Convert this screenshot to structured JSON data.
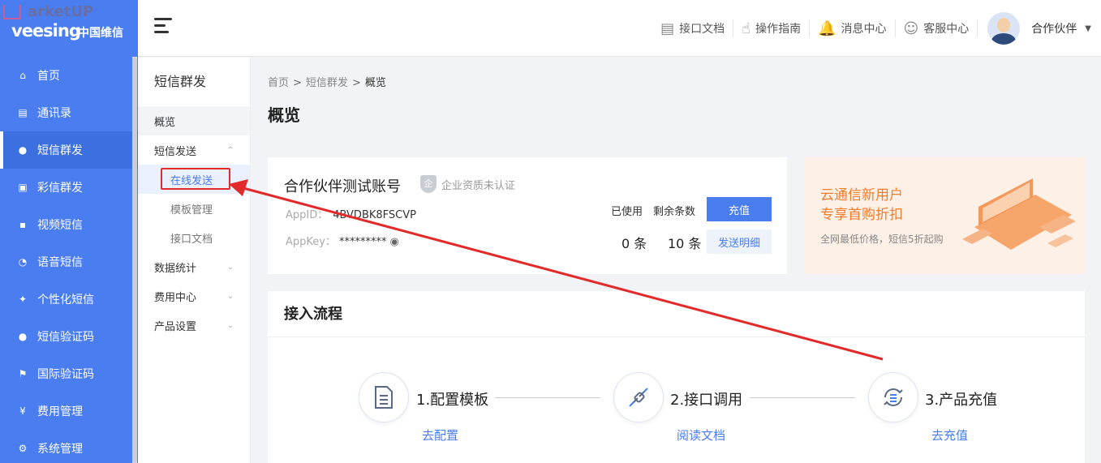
{
  "logo": {
    "watermark": "arketUP",
    "brand": "veesing",
    "brand_cn": "中国维信"
  },
  "sidebar": {
    "items": [
      {
        "label": "首页",
        "icon": "home-icon"
      },
      {
        "label": "通讯录",
        "icon": "contacts-icon"
      },
      {
        "label": "短信群发",
        "icon": "sms-icon"
      },
      {
        "label": "彩信群发",
        "icon": "mms-icon"
      },
      {
        "label": "视频短信",
        "icon": "video-sms-icon"
      },
      {
        "label": "语音短信",
        "icon": "voice-sms-icon"
      },
      {
        "label": "个性化短信",
        "icon": "personalized-sms-icon"
      },
      {
        "label": "短信验证码",
        "icon": "sms-code-icon"
      },
      {
        "label": "国际验证码",
        "icon": "intl-code-icon"
      },
      {
        "label": "费用管理",
        "icon": "yen-icon"
      },
      {
        "label": "系统管理",
        "icon": "gear-icon"
      }
    ],
    "active_index": 2
  },
  "header": {
    "links": [
      {
        "label": "接口文档",
        "icon": "api-doc-icon"
      },
      {
        "label": "操作指南",
        "icon": "hand-pointer-icon"
      },
      {
        "label": "消息中心",
        "icon": "bell-icon"
      },
      {
        "label": "客服中心",
        "icon": "support-icon"
      }
    ],
    "user": "合作伙伴"
  },
  "subnav": {
    "title": "短信群发",
    "overview": "概览",
    "send": "短信发送",
    "send_children": [
      "在线发送",
      "模板管理",
      "接口文档"
    ],
    "stats": "数据统计",
    "billing": "费用中心",
    "product": "产品设置"
  },
  "breadcrumb": {
    "home": "首页",
    "section": "短信群发",
    "current": "概览",
    "sep": ">"
  },
  "page_title": "概览",
  "account": {
    "name": "合作伙伴测试账号",
    "cert_badge": "企",
    "cert_text": "企业资质未认证",
    "appid_label": "AppID：",
    "appid_value": "4BVDBK8FSCVP",
    "appkey_label": "AppKey：",
    "appkey_value": "*********",
    "used_label": "已使用",
    "remain_label": "剩余条数",
    "used_value": "0 条",
    "remain_value": "10 条",
    "recharge_button": "充值",
    "detail_button": "发送明细"
  },
  "promo": {
    "line1": "云通信新用户",
    "line2": "专享首购折扣",
    "sub": "全网最低价格，短信5折起购"
  },
  "flow": {
    "title": "接入流程",
    "steps": [
      {
        "label": "1.配置模板",
        "link": "去配置",
        "icon": "document-icon"
      },
      {
        "label": "2.接口调用",
        "link": "阅读文档",
        "icon": "plug-icon"
      },
      {
        "label": "3.产品充值",
        "link": "去充值",
        "icon": "recharge-cycle-icon"
      }
    ]
  },
  "colors": {
    "primary": "#4a7df0",
    "promo_orange": "#f07d2d",
    "annotation_red": "#e32a2a"
  }
}
